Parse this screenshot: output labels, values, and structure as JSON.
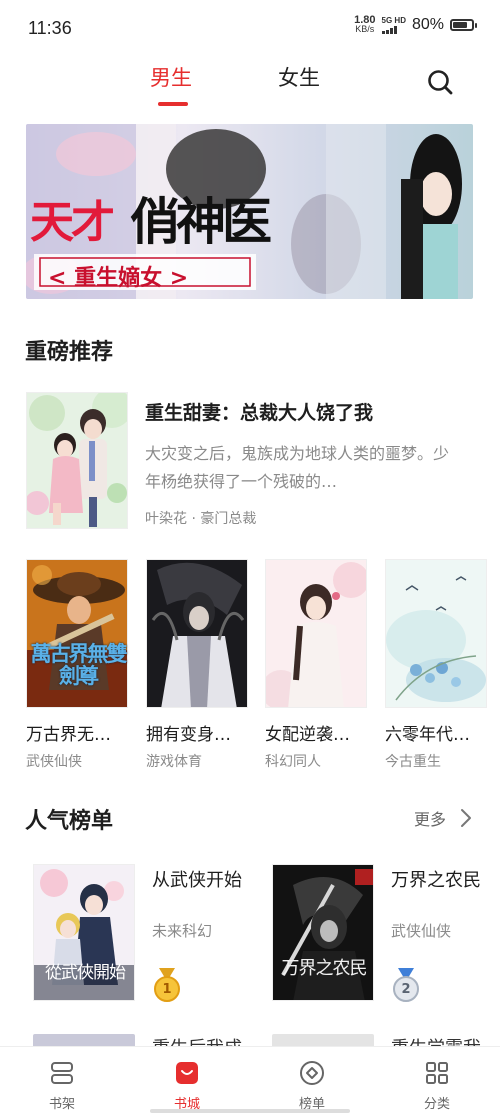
{
  "status_bar": {
    "time": "11:36",
    "net_speed_value": "1.80",
    "net_speed_unit": "KB/s",
    "network": "5G HD",
    "battery": "80%",
    "battery_level": 0.8
  },
  "top_tabs": [
    {
      "label": "男生",
      "active": true
    },
    {
      "label": "女生",
      "active": false
    }
  ],
  "banner": {
    "title_red": "天才",
    "title_black": "俏神医",
    "subtitle": "< 重生嫡女 >"
  },
  "featured_section": {
    "title": "重磅推荐",
    "book": {
      "title": "重生甜妻：总裁大人饶了我",
      "description": "大灾变之后，鬼族成为地球人类的噩梦。少年杨绝获得了一个残破的…",
      "meta": "叶染花 · 豪门总裁"
    },
    "grid": [
      {
        "title": "万古界无…",
        "tag": "武侠仙侠",
        "cover_text": "萬古界無雙劍尊"
      },
      {
        "title": "拥有变身…",
        "tag": "游戏体育",
        "cover_text": ""
      },
      {
        "title": "女配逆袭…",
        "tag": "科幻同人",
        "cover_text": ""
      },
      {
        "title": "六零年代…",
        "tag": "今古重生",
        "cover_text": ""
      }
    ]
  },
  "ranking_section": {
    "title": "人气榜单",
    "more_label": "更多",
    "books": [
      {
        "title": "从武侠开始",
        "tag": "未来科幻",
        "rank": "1",
        "cover_text": "從武俠開始"
      },
      {
        "title": "万界之农民",
        "tag": "武侠仙侠",
        "rank": "2",
        "cover_text": "万界之农民"
      }
    ],
    "partial_titles": [
      "重生后我成",
      "重生学霸我"
    ]
  },
  "bottom_nav": [
    {
      "label": "书架",
      "icon": "bookshelf-icon",
      "active": false
    },
    {
      "label": "书城",
      "icon": "bookstore-bag-icon",
      "active": true
    },
    {
      "label": "榜单",
      "icon": "ranking-diamond-icon",
      "active": false
    },
    {
      "label": "分类",
      "icon": "category-grid-icon",
      "active": false
    }
  ],
  "colors": {
    "accent": "#e62e2e",
    "text_primary": "#1e1e1e",
    "text_secondary": "#8a8a8a"
  }
}
